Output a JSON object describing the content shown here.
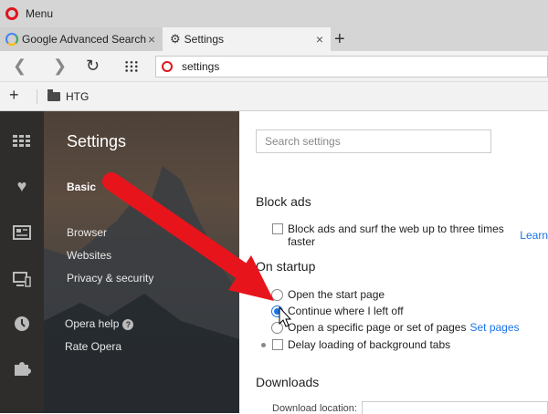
{
  "titlebar": {
    "menu_label": "Menu"
  },
  "tabs": [
    {
      "label": "Google Advanced Search",
      "close": "×"
    },
    {
      "label": "Settings",
      "close": "×"
    }
  ],
  "newtab_glyph": "+",
  "address": {
    "url": "settings"
  },
  "bookmarks": {
    "add_glyph": "+",
    "folder_label": "HTG"
  },
  "menu": {
    "title": "Settings",
    "items": [
      "Basic",
      "Browser",
      "Websites",
      "Privacy & security",
      "Opera help",
      "Rate Opera"
    ],
    "help_glyph": "?"
  },
  "sidebar_icons": [
    "speed-dial-icon",
    "heart-icon",
    "news-icon",
    "devices-icon",
    "history-icon",
    "extensions-icon"
  ],
  "content": {
    "search_placeholder": "Search settings",
    "block_ads": {
      "title": "Block ads",
      "option": "Block ads and surf the web up to three times faster",
      "link": "Learn"
    },
    "startup": {
      "title": "On startup",
      "options": [
        "Open the start page",
        "Continue where I left off",
        "Open a specific page or set of pages"
      ],
      "set_pages_link": "Set pages",
      "selected": 1,
      "delay_option": "Delay loading of background tabs"
    },
    "downloads": {
      "title": "Downloads",
      "location_label": "Download location:"
    }
  },
  "colors": {
    "accent": "#1a73e8",
    "opera_red": "#e0151d",
    "arrow_red": "#e8141c"
  }
}
